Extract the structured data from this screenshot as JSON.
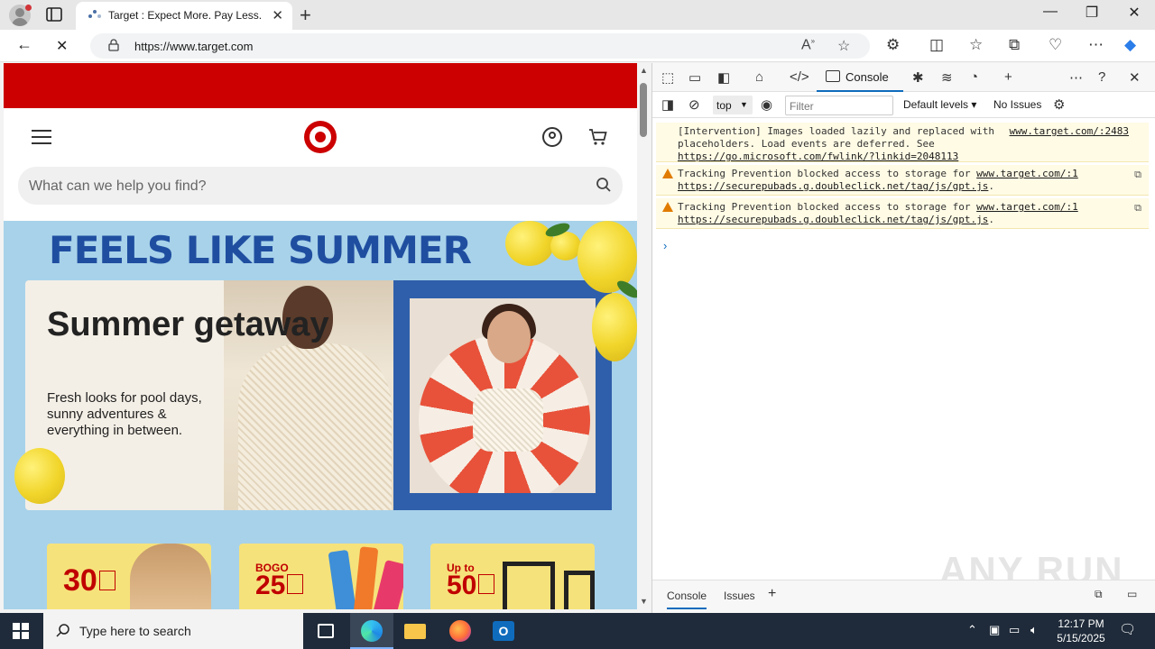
{
  "browser": {
    "tab_title": "Target : Expect More. Pay Less.",
    "tab_close": "✕",
    "new_tab": "+",
    "url_domain": "https://www.target.com",
    "window": {
      "minimize": "—",
      "maximize": "❐",
      "close": "✕"
    }
  },
  "page": {
    "search_placeholder": "What can we help you find?",
    "headline": "FEELS LIKE SUMMER",
    "hero_title": "Summer getaway",
    "hero_description": "Fresh looks for pool days, sunny adventures & everything in between.",
    "promos": [
      {
        "small": "",
        "big": "30"
      },
      {
        "small": "BOGO",
        "big": "25"
      },
      {
        "small": "Up to",
        "big": "50"
      }
    ]
  },
  "devtools": {
    "active_tab": "Console",
    "context": "top",
    "filter_placeholder": "Filter",
    "levels": "Default levels",
    "issues": "No Issues",
    "messages": [
      {
        "type": "info",
        "text": "[Intervention] Images loaded lazily and replaced with placeholders. Load events are deferred. See ",
        "source": "www.target.com/:2483",
        "link": "https://go.microsoft.com/fwlink/?linkid=2048113"
      },
      {
        "type": "warning",
        "text": "Tracking Prevention blocked access to storage for ",
        "source": "www.target.com/:1",
        "link": "https://securepubads.g.doubleclick.net/tag/js/gpt.js"
      },
      {
        "type": "warning",
        "text": "Tracking Prevention blocked access to storage for ",
        "source": "www.target.com/:1",
        "link": "https://securepubads.g.doubleclick.net/tag/js/gpt.js"
      }
    ],
    "drawer_tabs": [
      "Console",
      "Issues"
    ],
    "watermark": "ANY RUN"
  },
  "taskbar": {
    "search_placeholder": "Type here to search",
    "time": "12:17 PM",
    "date": "5/15/2025"
  },
  "colors": {
    "target_red": "#cc0000",
    "headline_blue": "#1f4ea0",
    "banner_bg": "#a8d2ea",
    "devtools_accent": "#0f6cbd",
    "warning_bg": "#fffbe5"
  }
}
